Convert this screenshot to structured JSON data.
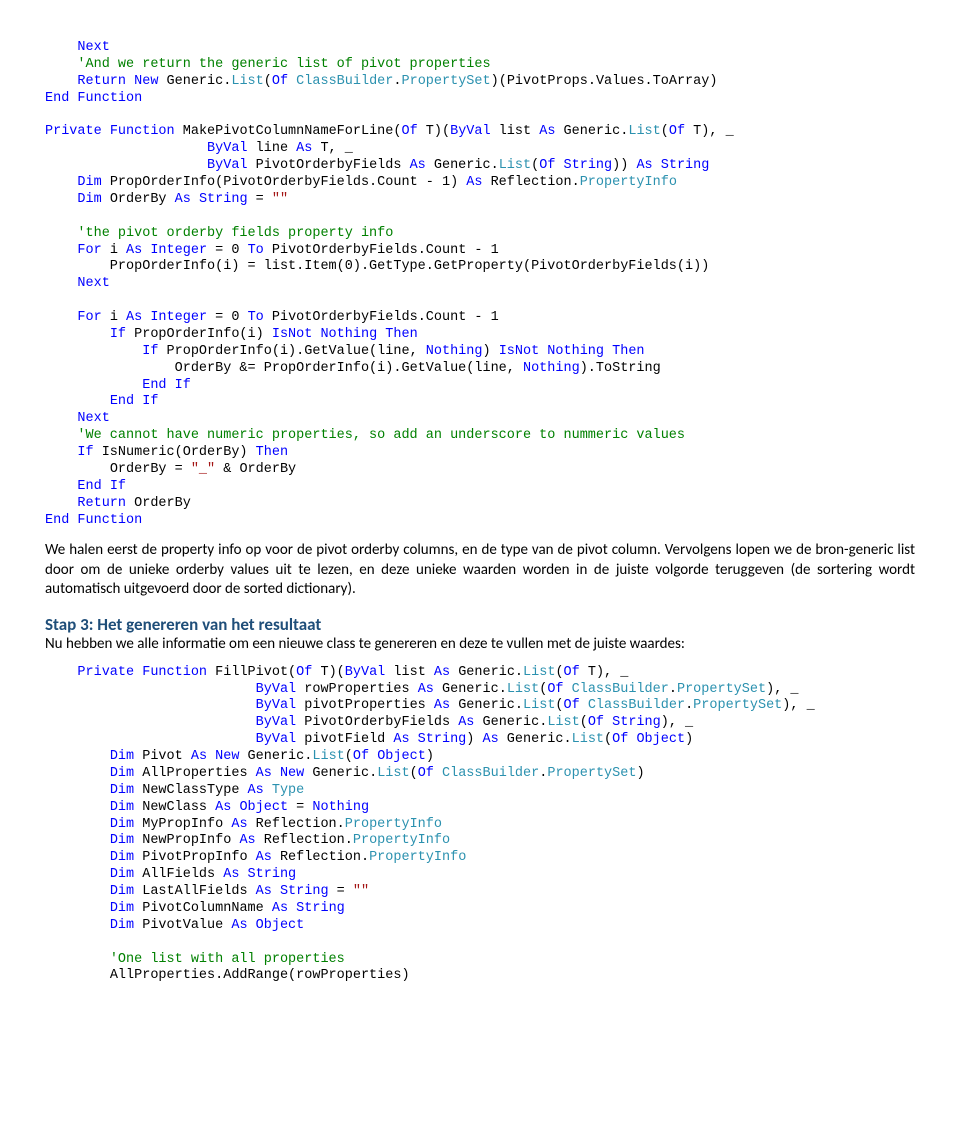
{
  "block1": {
    "l1_kw": "Next",
    "l2_cmt": "'And we return the generic list of pivot properties",
    "l3a": "Return",
    "l3b": " New",
    "l3c": " Generic.",
    "l3d": "List",
    "l3e": "(",
    "l3f": "Of",
    "l3g": " ClassBuilder",
    "l3h": ".",
    "l3i": "PropertySet",
    "l3j": ")(PivotProps.Values.ToArray)",
    "l4a": "End",
    "l4b": " Function",
    "l6a": "Private",
    "l6b": " Function",
    "l6c": " MakePivotColumnNameForLine(",
    "l6d": "Of",
    "l6e": " T)(",
    "l6f": "ByVal",
    "l6g": " list ",
    "l6h": "As",
    "l6i": " Generic.",
    "l6j": "List",
    "l6k": "(",
    "l6l": "Of",
    "l6m": " T), _",
    "l7a": "ByVal",
    "l7b": " line ",
    "l7c": "As",
    "l7d": " T, _",
    "l8a": "ByVal",
    "l8b": " PivotOrderbyFields ",
    "l8c": "As",
    "l8d": " Generic.",
    "l8e": "List",
    "l8f": "(",
    "l8g": "Of",
    "l8h": " String",
    "l8i": ")) ",
    "l8j": "As",
    "l8k": " String",
    "l9a": "Dim",
    "l9b": " PropOrderInfo(PivotOrderbyFields.Count - 1) ",
    "l9c": "As",
    "l9d": " Reflection.",
    "l9e": "PropertyInfo",
    "l10a": "Dim",
    "l10b": " OrderBy ",
    "l10c": "As",
    "l10d": " String",
    "l10e": " = ",
    "l10f": "\"\"",
    "l12_cmt": "'the pivot orderby fields property info",
    "l13a": "For",
    "l13b": " i ",
    "l13c": "As",
    "l13d": " Integer",
    "l13e": " = 0 ",
    "l13f": "To",
    "l13g": " PivotOrderbyFields.Count - 1",
    "l14": "    PropOrderInfo(i) = list.Item(0).GetType.GetProperty(PivotOrderbyFields(i))",
    "l15": "Next",
    "l17a": "For",
    "l17b": " i ",
    "l17c": "As",
    "l17d": " Integer",
    "l17e": " = 0 ",
    "l17f": "To",
    "l17g": " PivotOrderbyFields.Count - 1",
    "l18a": "If",
    "l18b": " PropOrderInfo(i) ",
    "l18c": "IsNot",
    "l18d": " Nothing",
    "l18e": " Then",
    "l19a": "If",
    "l19b": " PropOrderInfo(i).GetValue(line, ",
    "l19c": "Nothing",
    "l19d": ") ",
    "l19e": "IsNot",
    "l19f": " Nothing",
    "l19g": " Then",
    "l20a": "OrderBy &= PropOrderInfo(i).GetValue(line, ",
    "l20b": "Nothing",
    "l20c": ").ToString",
    "l21a": "End",
    "l21b": " If",
    "l22a": "End",
    "l22b": " If",
    "l23": "Next",
    "l24_cmt": "'We cannot have numeric properties, so add an underscore to nummeric values",
    "l25a": "If",
    "l25b": " IsNumeric(OrderBy) ",
    "l25c": "Then",
    "l26a": "OrderBy = ",
    "l26b": "\"_\"",
    "l26c": " & OrderBy",
    "l27a": "End",
    "l27b": " If",
    "l28a": "Return",
    "l28b": " OrderBy",
    "l29a": "End",
    "l29b": " Function"
  },
  "prose1": "We halen eerst de property info op voor de pivot orderby columns, en de type van de pivot column. Vervolgens lopen we de bron-generic list door om de unieke orderby values uit te lezen, en deze unieke waarden worden in de juiste volgorde teruggeven (de sortering wordt automatisch uitgevoerd door de sorted dictionary).",
  "step3_title": "Stap 3: Het genereren van het resultaat",
  "prose2": "Nu hebben we alle informatie om een nieuwe class te genereren en deze te vullen met de juiste waardes:",
  "block2": {
    "l1a": "Private",
    "l1b": " Function",
    "l1c": " FillPivot(",
    "l1d": "Of",
    "l1e": " T)(",
    "l1f": "ByVal",
    "l1g": " list ",
    "l1h": "As",
    "l1i": " Generic.",
    "l1j": "List",
    "l1k": "(",
    "l1l": "Of",
    "l1m": " T), _",
    "l2a": "ByVal",
    "l2b": " rowProperties ",
    "l2c": "As",
    "l2d": " Generic.",
    "l2e": "List",
    "l2f": "(",
    "l2g": "Of",
    "l2h": " ClassBuilder",
    "l2i": ".",
    "l2j": "PropertySet",
    "l2k": "), _",
    "l3a": "ByVal",
    "l3b": " pivotProperties ",
    "l3c": "As",
    "l3d": " Generic.",
    "l3e": "List",
    "l3f": "(",
    "l3g": "Of",
    "l3h": " ClassBuilder",
    "l3i": ".",
    "l3j": "PropertySet",
    "l3k": "), _",
    "l4a": "ByVal",
    "l4b": " PivotOrderbyFields ",
    "l4c": "As",
    "l4d": " Generic.",
    "l4e": "List",
    "l4f": "(",
    "l4g": "Of",
    "l4h": " String",
    "l4i": "), _",
    "l5a": "ByVal",
    "l5b": " pivotField ",
    "l5c": "As",
    "l5d": " String",
    "l5e": ") ",
    "l5f": "As",
    "l5g": " Generic.",
    "l5h": "List",
    "l5i": "(",
    "l5j": "Of",
    "l5k": " Object",
    "l5l": ")",
    "l6a": "Dim",
    "l6b": " Pivot ",
    "l6c": "As",
    "l6d": " New",
    "l6e": " Generic.",
    "l6f": "List",
    "l6g": "(",
    "l6h": "Of",
    "l6i": " Object",
    "l6j": ")",
    "l7a": "Dim",
    "l7b": " AllProperties ",
    "l7c": "As",
    "l7d": " New",
    "l7e": " Generic.",
    "l7f": "List",
    "l7g": "(",
    "l7h": "Of",
    "l7i": " ClassBuilder",
    "l7j": ".",
    "l7k": "PropertySet",
    "l7l": ")",
    "l8a": "Dim",
    "l8b": " NewClassType ",
    "l8c": "As",
    "l8d": " Type",
    "l9a": "Dim",
    "l9b": " NewClass ",
    "l9c": "As",
    "l9d": " Object",
    "l9e": " = ",
    "l9f": "Nothing",
    "l10a": "Dim",
    "l10b": " MyPropInfo ",
    "l10c": "As",
    "l10d": " Reflection.",
    "l10e": "PropertyInfo",
    "l11a": "Dim",
    "l11b": " NewPropInfo ",
    "l11c": "As",
    "l11d": " Reflection.",
    "l11e": "PropertyInfo",
    "l12a": "Dim",
    "l12b": " PivotPropInfo ",
    "l12c": "As",
    "l12d": " Reflection.",
    "l12e": "PropertyInfo",
    "l13a": "Dim",
    "l13b": " AllFields ",
    "l13c": "As",
    "l13d": " String",
    "l14a": "Dim",
    "l14b": " LastAllFields ",
    "l14c": "As",
    "l14d": " String",
    "l14e": " = ",
    "l14f": "\"\"",
    "l15a": "Dim",
    "l15b": " PivotColumnName ",
    "l15c": "As",
    "l15d": " String",
    "l16a": "Dim",
    "l16b": " PivotValue ",
    "l16c": "As",
    "l16d": " Object",
    "l18_cmt": "'One list with all properties",
    "l19": "AllProperties.AddRange(rowProperties)"
  }
}
